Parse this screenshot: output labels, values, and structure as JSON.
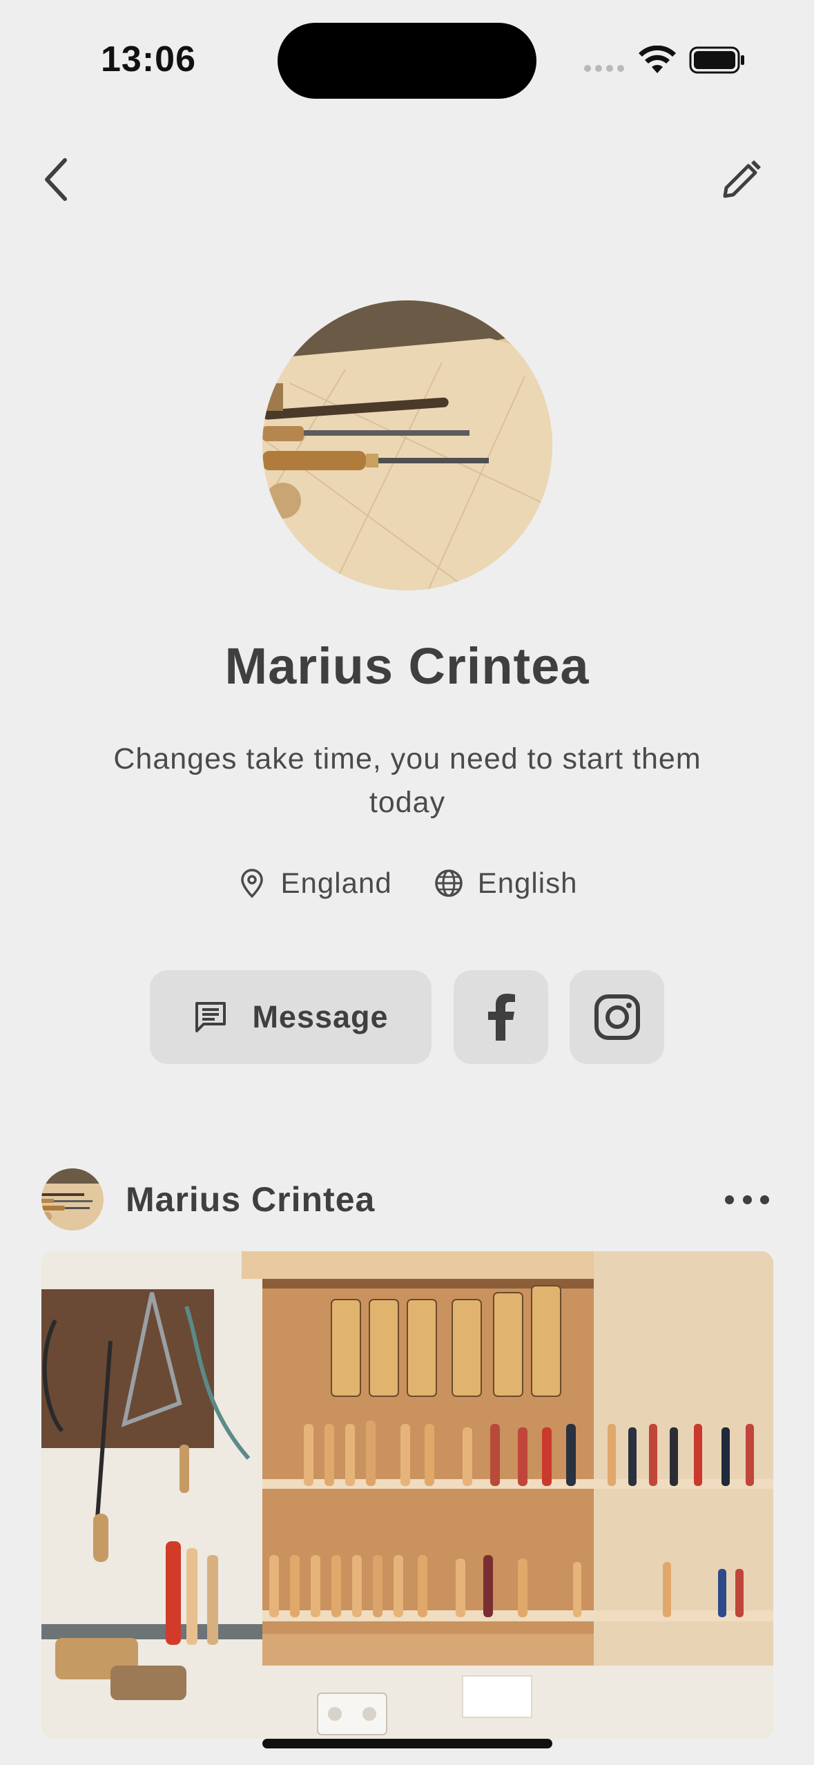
{
  "status_bar": {
    "time": "13:06"
  },
  "nav": {
    "back_icon": "chevron-left-icon",
    "edit_icon": "pencil-icon"
  },
  "profile": {
    "name": "Marius Crintea",
    "bio": "Changes take time, you need to start them today",
    "location": "England",
    "language": "English",
    "location_icon": "map-pin-icon",
    "language_icon": "globe-icon"
  },
  "actions": {
    "message_label": "Message",
    "message_icon": "message-icon",
    "facebook_icon": "facebook-icon",
    "instagram_icon": "instagram-icon"
  },
  "post": {
    "author": "Marius Crintea",
    "more_icon": "more-horizontal-icon"
  },
  "colors": {
    "background": "#eeeeee",
    "button_bg": "#dedede",
    "text_primary": "#3f3f3f"
  }
}
